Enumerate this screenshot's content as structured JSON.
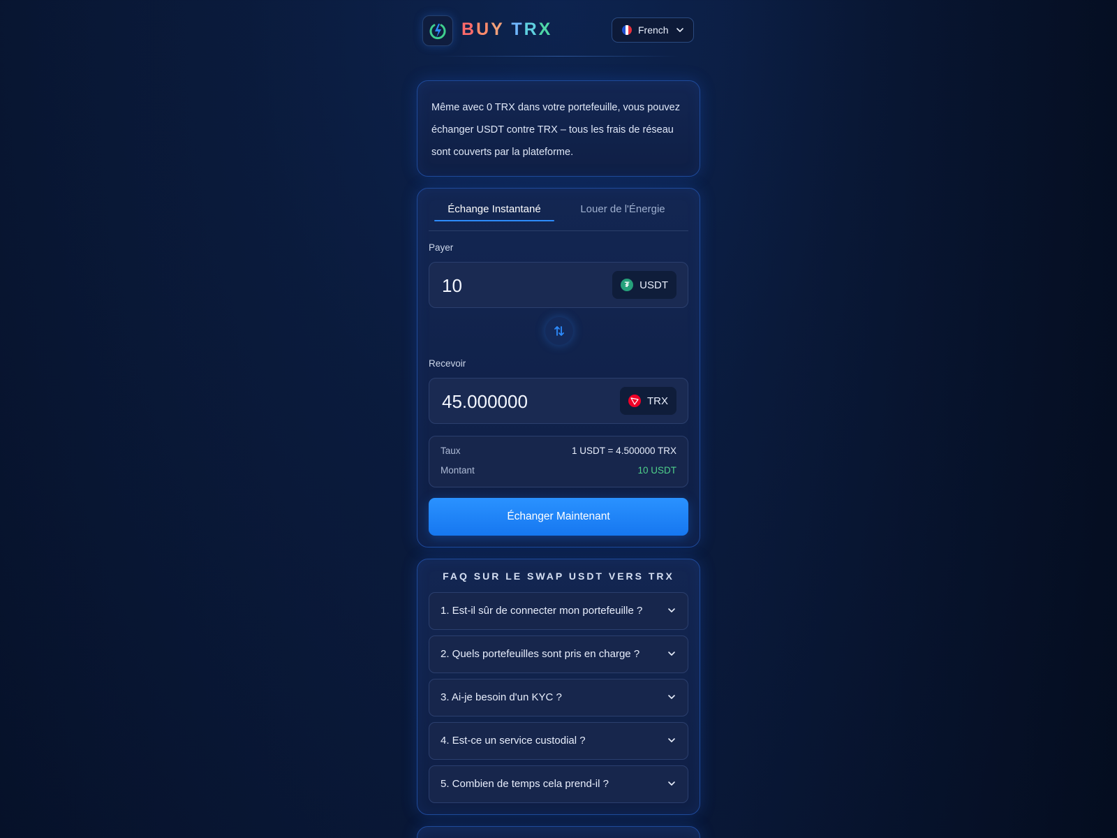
{
  "header": {
    "brand_letters": [
      "B",
      "U",
      "Y",
      "T",
      "R",
      "X"
    ],
    "language": "French"
  },
  "info": {
    "text": "Même avec 0 TRX dans votre portefeuille, vous pouvez échanger USDT contre TRX – tous les frais de réseau sont couverts par la plateforme."
  },
  "swap": {
    "tabs": [
      {
        "label": "Échange Instantané",
        "active": true
      },
      {
        "label": "Louer de l'Énergie",
        "active": false
      }
    ],
    "pay": {
      "label": "Payer",
      "value": "10",
      "token": "USDT"
    },
    "receive": {
      "label": "Recevoir",
      "value": "45.000000",
      "token": "TRX"
    },
    "details": {
      "rate_label": "Taux",
      "rate_value": "1 USDT = 4.500000 TRX",
      "amount_label": "Montant",
      "amount_value": "10 USDT"
    },
    "cta_label": "Échanger Maintenant"
  },
  "faq": {
    "title": "FAQ SUR LE SWAP USDT VERS TRX",
    "items": [
      "1. Est-il sûr de connecter mon portefeuille ?",
      "2. Quels portefeuilles sont pris en charge ?",
      "3. Ai-je besoin d'un KYC ?",
      "4. Est-ce un service custodial ?",
      "5. Combien de temps cela prend-il ?"
    ]
  },
  "colors": {
    "accent": "#2d8cff",
    "success": "#4fd18b",
    "usdt": "#26a17b",
    "trx": "#ef0027"
  },
  "icons": {
    "logo": "power-logo-icon",
    "flag": "france-flag-icon",
    "swap": "swap-arrows-icon",
    "chevron": "chevron-down-icon"
  }
}
